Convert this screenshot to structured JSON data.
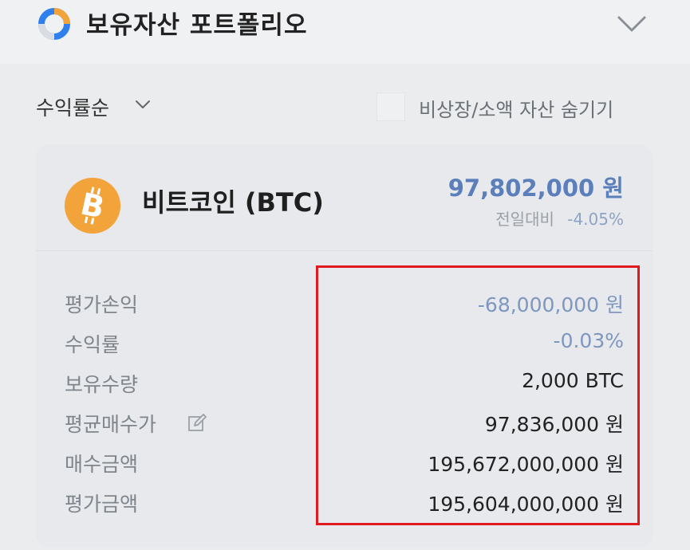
{
  "header": {
    "title": "보유자산 포트폴리오"
  },
  "filters": {
    "sort_label": "수익률순",
    "hide_label": "비상장/소액 자산 숨기기",
    "hide_checked": false
  },
  "coin": {
    "name": "비트코인 (BTC)",
    "price": "97,802,000 원",
    "change_label": "전일대비",
    "change_value": "-4.05%"
  },
  "rows": [
    {
      "label": "평가손익",
      "value": "-68,000,000 원"
    },
    {
      "label": "수익률",
      "value": "-0.03%"
    },
    {
      "label": "보유수량",
      "value": "2,000 BTC"
    },
    {
      "label": "평균매수가",
      "value": "97,836,000 원"
    },
    {
      "label": "매수금액",
      "value": "195,672,000,000 원"
    },
    {
      "label": "평가금액",
      "value": "195,604,000,000 원"
    }
  ],
  "colors": {
    "accent_blue": "#5b7fba",
    "highlight_red": "#e0191e",
    "btc_orange": "#f2a33a"
  },
  "icons": {
    "portfolio": "pie-chart-icon",
    "collapse": "chevron-down-icon",
    "coin": "bitcoin-icon",
    "edit": "edit-icon"
  }
}
